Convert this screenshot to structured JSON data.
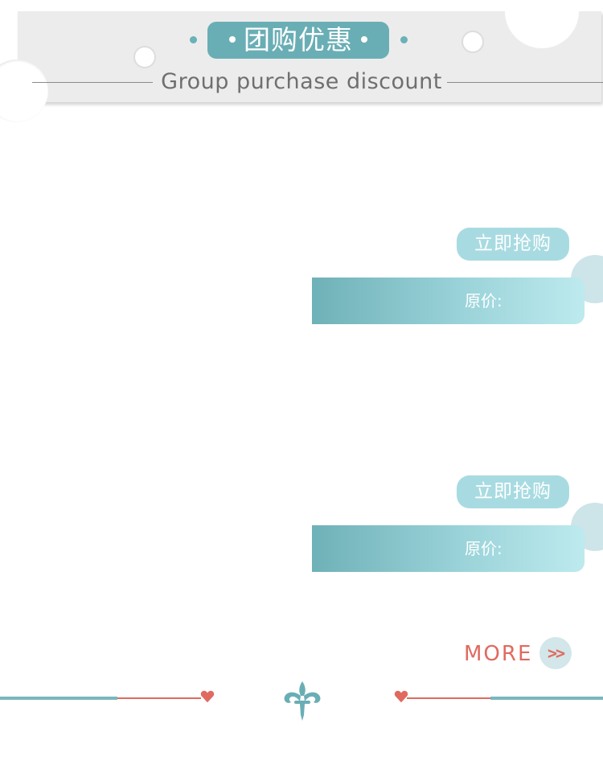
{
  "header": {
    "title": "团购优惠",
    "subtitle": "Group purchase discount"
  },
  "deals": [
    {
      "buy_label": "立即抢购",
      "price_label": "原价:"
    },
    {
      "buy_label": "立即抢购",
      "price_label": "原价:"
    }
  ],
  "more": {
    "label": "MORE",
    "arrow": ">>"
  },
  "colors": {
    "teal": "#6aaeb5",
    "light_teal": "#a8dbe1",
    "coral": "#e06a60",
    "header_bg": "#ececec"
  },
  "icons": {
    "heart": "heart-icon",
    "ornament": "fleur-de-lis-icon",
    "arrow": "double-chevron-right-icon"
  }
}
